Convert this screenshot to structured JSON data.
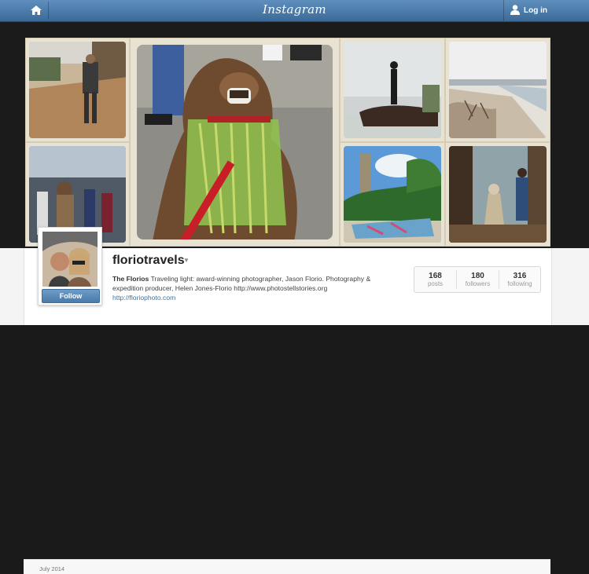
{
  "topbar": {
    "brand": "Instagram",
    "home_icon": "home-icon",
    "login_icon": "user-icon",
    "login_label": "Log in"
  },
  "profile": {
    "username": "floriotravels",
    "follow_label": "Follow",
    "bio_name": "The Florios",
    "bio_text": "Traveling light: award-winning photographer, Jason Florio. Photography & expedition producer, Helen Jones-Florio http://www.photostellstories.org",
    "website": "http://floriophoto.com",
    "stats": [
      {
        "count": "168",
        "label": "posts"
      },
      {
        "count": "180",
        "label": "followers"
      },
      {
        "count": "316",
        "label": "following"
      }
    ]
  },
  "feed": {
    "date_label": "July 2014"
  },
  "colors": {
    "topbar": "#4a7aab",
    "link": "#3f729b",
    "tile_frame": "#e8e2d2"
  }
}
